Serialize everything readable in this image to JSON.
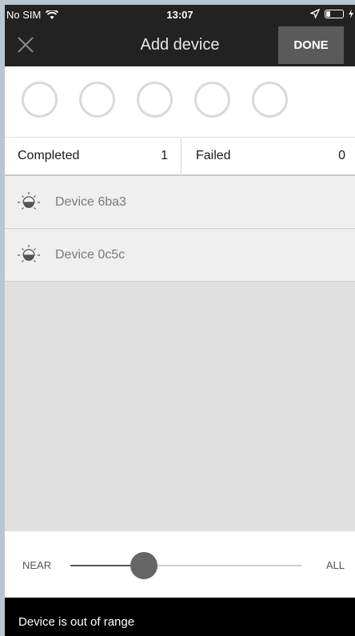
{
  "status_bar": {
    "carrier": "No SIM",
    "time": "13:07",
    "battery_level": 0.25,
    "icons": [
      "wifi-icon",
      "location-arrow-icon",
      "battery-icon",
      "charging-icon"
    ]
  },
  "header": {
    "title": "Add device",
    "done_label": "DONE",
    "close_icon": "close-icon"
  },
  "progress": {
    "circle_count": 5
  },
  "stats": {
    "completed_label": "Completed",
    "completed_value": "1",
    "failed_label": "Failed",
    "failed_value": "0"
  },
  "devices": [
    {
      "name": "Device 6ba3",
      "icon": "bulb-icon"
    },
    {
      "name": "Device 0c5c",
      "icon": "bulb-icon"
    }
  ],
  "range_slider": {
    "min_label": "NEAR",
    "max_label": "ALL",
    "value": 0.32
  },
  "snackbar": {
    "message": "Device is out of range"
  },
  "colors": {
    "header_bg": "#222222",
    "done_bg": "#5a5a5a",
    "list_bg": "#e0e0e0",
    "slider_thumb": "#666666",
    "snackbar_bg": "#000000"
  }
}
